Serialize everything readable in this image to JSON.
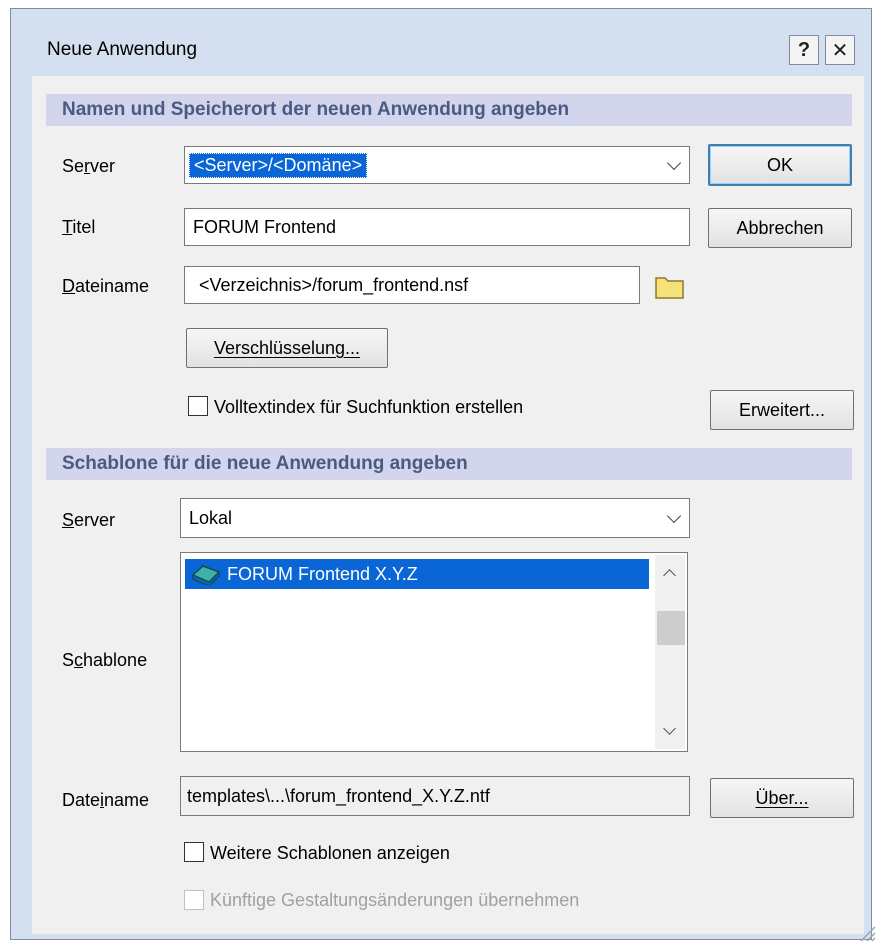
{
  "window": {
    "title": "Neue Anwendung",
    "help_glyph": "?",
    "close_glyph": "✕"
  },
  "section1": {
    "heading": "Namen und Speicherort der neuen Anwendung angeben",
    "server_label": "Server",
    "server_value": "<Server>/<Domäne>",
    "title_label": "Titel",
    "title_value": "FORUM Frontend",
    "filename_label": "Dateiname",
    "filename_value": "<Verzeichnis>/forum_frontend.nsf",
    "encryption_button": "Verschlüsselung...",
    "fulltext_label": "Volltextindex für Suchfunktion erstellen",
    "fulltext_checked": false,
    "advanced_button": "Erweitert..."
  },
  "buttons": {
    "ok": "OK",
    "cancel": "Abbrechen"
  },
  "section2": {
    "heading": "Schablone für die neue Anwendung angeben",
    "server_label": "Server",
    "server_value": "Lokal",
    "template_label": "Schablone",
    "templates": [
      {
        "name": "FORUM Frontend X.Y.Z",
        "icon": "database-book-icon",
        "selected": true
      }
    ],
    "filename_label": "Dateiname",
    "filename_value": "templates\\...\\forum_frontend_X.Y.Z.ntf",
    "about_button": "Über...",
    "more_templates_label": "Weitere Schablonen anzeigen",
    "more_templates_checked": false,
    "inherit_label": "Künftige Gestaltungsänderungen übernehmen",
    "inherit_checked": false,
    "inherit_enabled": false
  },
  "colors": {
    "accent": "#0a66d6",
    "section_bg": "#d2d5eb",
    "section_text": "#4a5a82",
    "frame": "#d4e0f0"
  },
  "icons": {
    "folder": "folder-icon",
    "dropdown": "chevron-down-icon",
    "resize": "resize-grip-icon"
  }
}
